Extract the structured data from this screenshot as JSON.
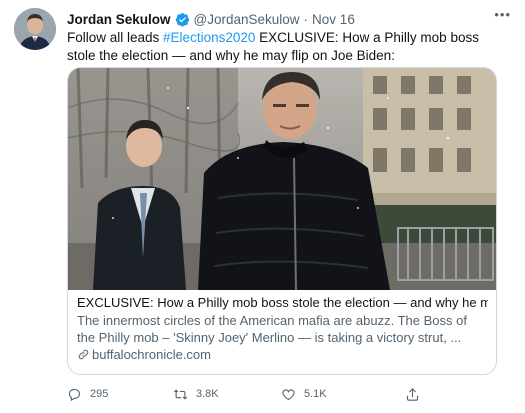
{
  "author": {
    "name": "Jordan Sekulow",
    "handle": "@JordanSekulow",
    "separator": "·",
    "date": "Nov 16",
    "avatar_icon": "profile-photo"
  },
  "more_label": "•••",
  "tweet": {
    "prefix": "Follow all leads ",
    "hashtag": "#Elections2020",
    "suffix": " EXCLUSIVE: How a Philly mob boss stole the election — and why he may flip on Joe Biden:"
  },
  "card": {
    "title": "EXCLUSIVE: How a Philly mob boss stole the election — and why he ma...",
    "description": "The innermost circles of the American mafia are abuzz.  The Boss of the Philly mob – 'Skinny Joey' Merlino — is taking a victory strut, ...",
    "domain": "buffalochronicle.com"
  },
  "actions": {
    "reply_count": "295",
    "retweet_count": "3.8K",
    "like_count": "5.1K"
  },
  "colors": {
    "accent": "#1d9bf0",
    "muted": "#536471",
    "border": "#cfd9de"
  }
}
